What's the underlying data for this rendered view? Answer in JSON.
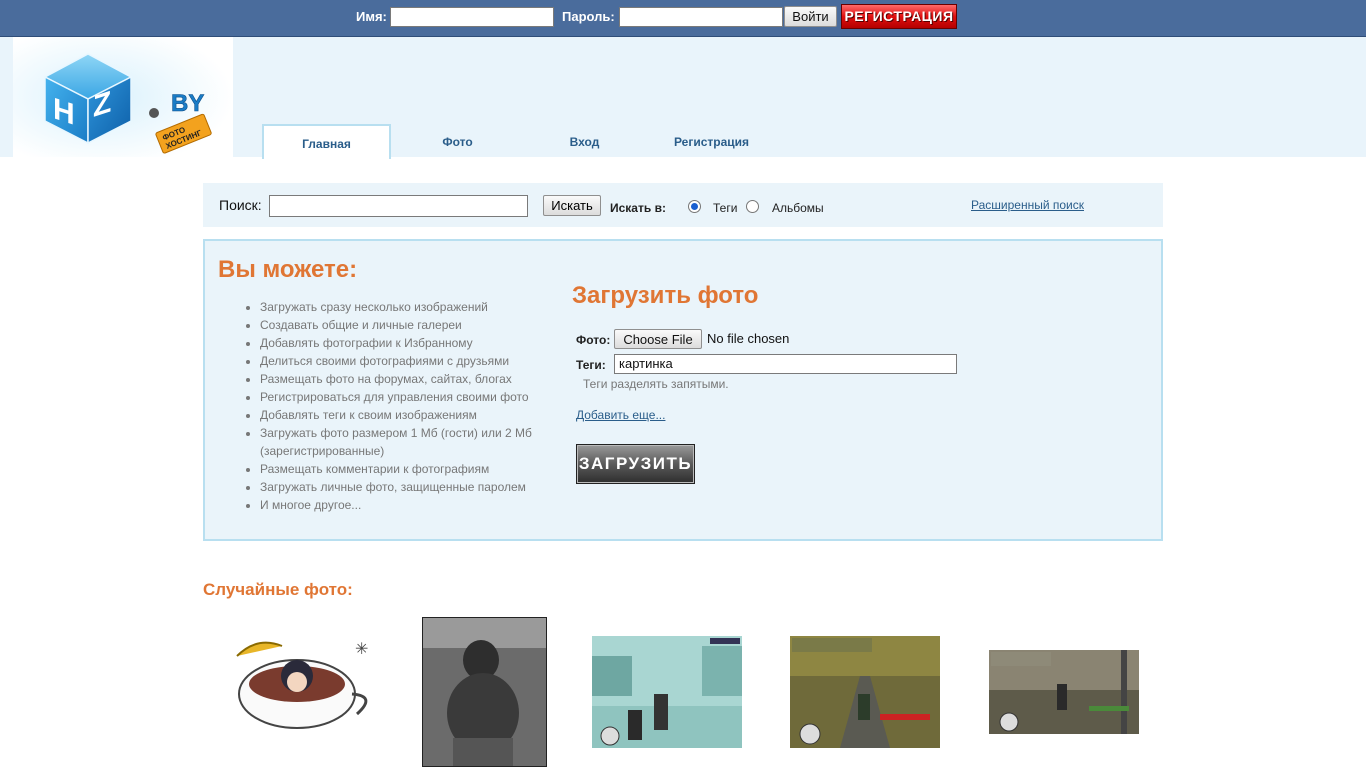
{
  "topbar": {
    "name_label": "Имя:",
    "name_value": "",
    "password_label": "Пароль:",
    "password_value": "",
    "login_button": "Войти",
    "register_button": "РЕГИСТРАЦИЯ"
  },
  "logo": {
    "text": "HZ",
    "suffix": "BY",
    "badge": "ФОТО ХОСТИНГ"
  },
  "nav": {
    "tabs": [
      {
        "label": "Главная",
        "active": true
      },
      {
        "label": "Фото",
        "active": false
      },
      {
        "label": "Вход",
        "active": false
      },
      {
        "label": "Регистрация",
        "active": false
      }
    ]
  },
  "search": {
    "label": "Поиск:",
    "query": "",
    "button": "Искать",
    "in_label": "Искать в:",
    "options": [
      {
        "label": "Теги",
        "selected": true
      },
      {
        "label": "Альбомы",
        "selected": false
      }
    ],
    "advanced_link": "Расширенный поиск"
  },
  "features": {
    "title": "Вы можете:",
    "items": [
      "Загружать сразу несколько изображений",
      "Создавать общие и личные галереи",
      "Добавлять фотографии к Избранному",
      "Делиться своими фотографиями с друзьями",
      "Размещать фото на форумах, сайтах, блогах",
      "Регистрироваться для управления своими фото",
      "Добавлять теги к своим изображениям",
      "Загружать фото размером 1 Мб (гости) или 2 Мб (зарегистрированные)",
      "Размещать комментарии к фотографиям",
      "Загружать личные фото, защищенные паролем",
      "И многое другое..."
    ]
  },
  "upload": {
    "title": "Загрузить фото",
    "photo_label": "Фото:",
    "choose_button": "Choose File",
    "no_file": "No file chosen",
    "tags_label": "Теги:",
    "tags_value": "картинка",
    "tags_hint": "Теги разделять запятыми.",
    "add_more": "Добавить еще...",
    "submit": "ЗАГРУЗИТЬ"
  },
  "random": {
    "title": "Случайные фото:"
  },
  "colors": {
    "topbar": "#4a6c9c",
    "header_band": "#e9f4fb",
    "accent_orange": "#e07634",
    "link_blue": "#2a5d8a",
    "panel_border": "#b8dff0"
  }
}
